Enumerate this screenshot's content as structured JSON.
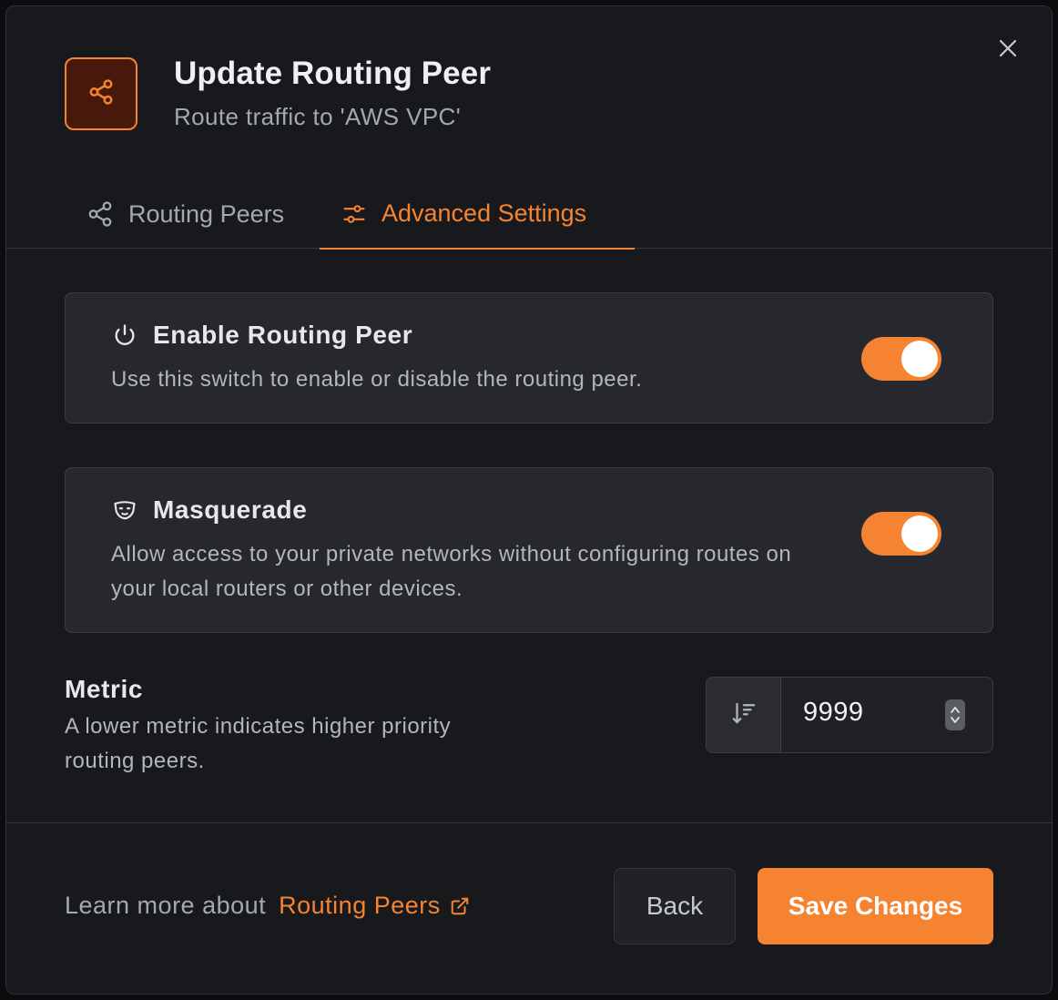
{
  "dialog": {
    "title": "Update Routing Peer",
    "subtitle": "Route traffic to 'AWS VPC'",
    "header_icon": "share-network-icon",
    "close_icon": "close-icon"
  },
  "tabs": [
    {
      "label": "Routing Peers",
      "icon": "share-network-icon",
      "active": false
    },
    {
      "label": "Advanced Settings",
      "icon": "sliders-icon",
      "active": true
    }
  ],
  "settings": {
    "enable": {
      "title": "Enable Routing Peer",
      "description": "Use this switch to enable or disable the routing peer.",
      "icon": "power-icon",
      "enabled": true
    },
    "masquerade": {
      "title": "Masquerade",
      "description": "Allow access to your private networks without configuring routes on your local routers or other devices.",
      "icon": "mask-icon",
      "enabled": true
    }
  },
  "metric": {
    "title": "Metric",
    "description": "A lower metric indicates higher priority routing peers.",
    "value": "9999",
    "icon": "sort-descending-icon"
  },
  "footer": {
    "learn_prefix": "Learn more about",
    "learn_link": "Routing Peers",
    "link_icon": "external-link-icon",
    "back_label": "Back",
    "save_label": "Save Changes"
  },
  "colors": {
    "accent": "#f68330",
    "background": "#18191c",
    "card": "#26282d"
  }
}
